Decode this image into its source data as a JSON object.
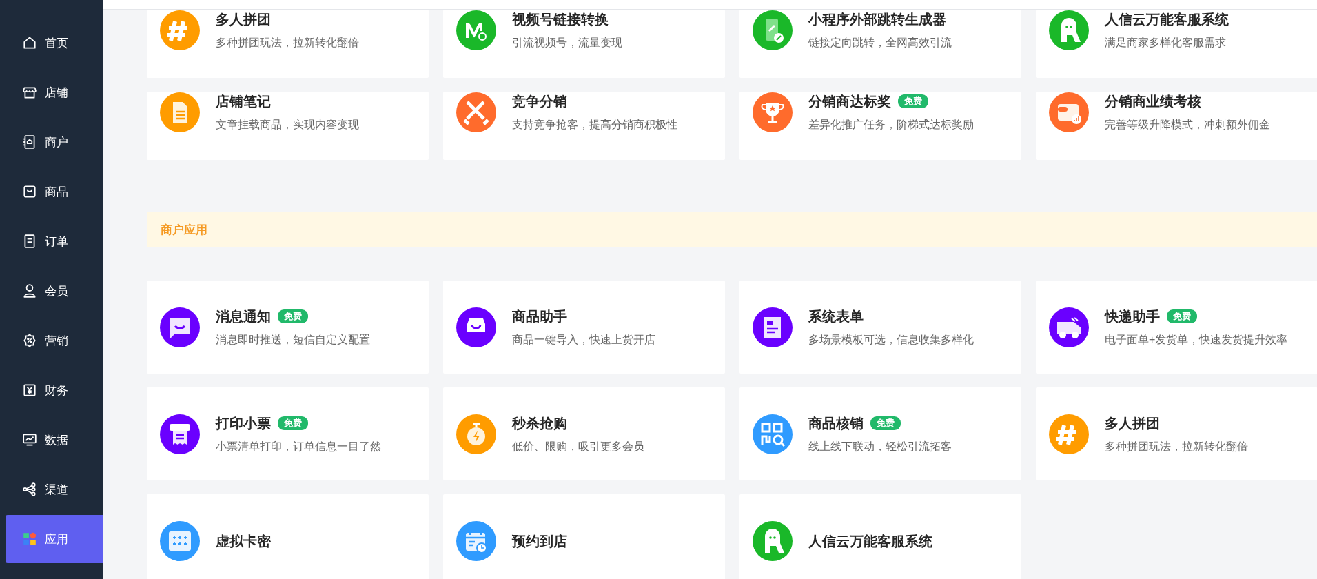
{
  "sidebar": {
    "items": [
      {
        "label": "首页",
        "kind": "home",
        "selected": false
      },
      {
        "label": "店铺",
        "kind": "store",
        "selected": false
      },
      {
        "label": "商户",
        "kind": "merchant",
        "selected": false
      },
      {
        "label": "商品",
        "kind": "bag",
        "selected": false
      },
      {
        "label": "订单",
        "kind": "order",
        "selected": false
      },
      {
        "label": "会员",
        "kind": "user",
        "selected": false
      },
      {
        "label": "营销",
        "kind": "discount",
        "selected": false
      },
      {
        "label": "财务",
        "kind": "yuan",
        "selected": false
      },
      {
        "label": "数据",
        "kind": "chart",
        "selected": false
      },
      {
        "label": "渠道",
        "kind": "share",
        "selected": false
      },
      {
        "label": "应用",
        "kind": "apps",
        "selected": true
      }
    ]
  },
  "sections": [
    {
      "cards": [
        {
          "title": "多人拼团",
          "desc": "多种拼团玩法，拉新转化翻倍",
          "kind": "hash",
          "color": "#ff9c00"
        },
        {
          "title": "视频号链接转换",
          "desc": "引流视频号，流量变现",
          "kind": "video",
          "color": "#1ab829"
        },
        {
          "title": "小程序外部跳转生成器",
          "desc": "链接定向跳转，全网高效引流",
          "kind": "phone",
          "color": "#1ab829"
        },
        {
          "title": "人信云万能客服系统",
          "desc": "满足商家多样化客服需求",
          "kind": "robot",
          "color": "#1ab829"
        },
        {
          "title": "店铺笔记",
          "desc": "文章挂载商品，实现内容变现",
          "kind": "note",
          "color": "#ff9c00"
        },
        {
          "title": "竞争分销",
          "desc": "支持竞争抢客，提高分销商积极性",
          "kind": "swords",
          "color": "#ff6b2c"
        },
        {
          "title": "分销商达标奖",
          "desc": "差异化推广任务，阶梯式达标奖励",
          "kind": "trophy",
          "color": "#ff6b2c",
          "badge": "免费"
        },
        {
          "title": "分销商业绩考核",
          "desc": "完善等级升降模式，冲刺额外佣金",
          "kind": "wallet",
          "color": "#ff6b2c"
        }
      ]
    },
    {
      "title": "商户应用",
      "cards": [
        {
          "title": "消息通知",
          "desc": "消息即时推送，短信自定义配置",
          "kind": "chat",
          "color": "#6a00ff",
          "badge": "免费"
        },
        {
          "title": "商品助手",
          "desc": "商品一键导入，快速上货开店",
          "kind": "bag",
          "color": "#6a00ff"
        },
        {
          "title": "系统表单",
          "desc": "多场景模板可选，信息收集多样化",
          "kind": "form",
          "color": "#6a00ff"
        },
        {
          "title": "快递助手",
          "desc": "电子面单+发货单，快速发货提升效率",
          "kind": "truck",
          "color": "#6a00ff",
          "badge": "免费"
        },
        {
          "title": "打印小票",
          "desc": "小票清单打印，订单信息一目了然",
          "kind": "printer",
          "color": "#6a00ff",
          "badge": "免费"
        },
        {
          "title": "秒杀抢购",
          "desc": "低价、限购，吸引更多会员",
          "kind": "stopwatch",
          "color": "#ff9c00"
        },
        {
          "title": "商品核销",
          "desc": "线上线下联动，轻松引流拓客",
          "kind": "qr",
          "color": "#2f9bff",
          "badge": "免费"
        },
        {
          "title": "多人拼团",
          "desc": "多种拼团玩法，拉新转化翻倍",
          "kind": "hash",
          "color": "#ff9c00"
        },
        {
          "title": "虚拟卡密",
          "kind": "stars",
          "color": "#2f9bff"
        },
        {
          "title": "预约到店",
          "kind": "calendar",
          "color": "#2f9bff"
        },
        {
          "title": "人信云万能客服系统",
          "kind": "robot",
          "color": "#1ab829"
        }
      ]
    }
  ]
}
